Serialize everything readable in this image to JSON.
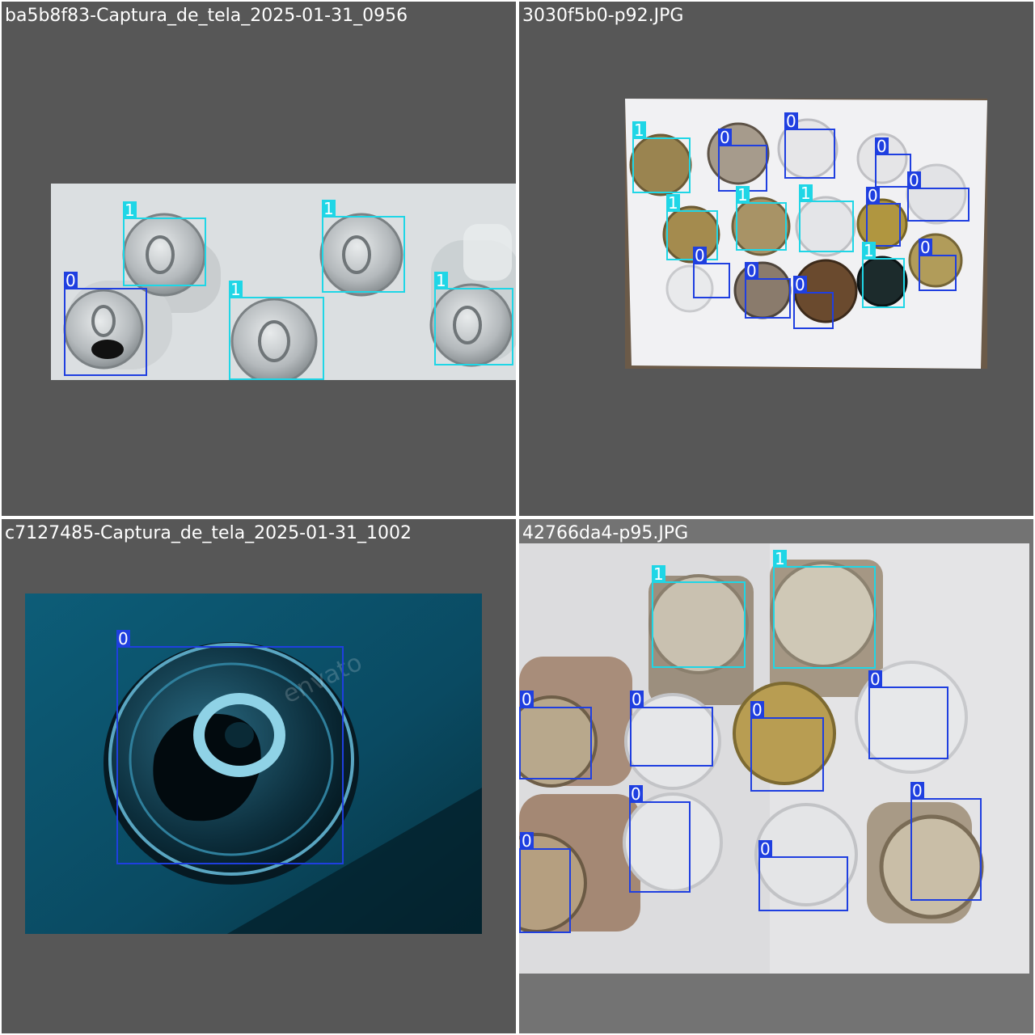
{
  "colors": {
    "class_0": "#1f3fe0",
    "class_1": "#1fd6e6",
    "tile_bg": "#575757",
    "title_text": "#ffffff"
  },
  "tiles": [
    {
      "title": "ba5b8f83-Captura_de_tela_2025-01-31_0956",
      "detections": [
        {
          "label": "1"
        },
        {
          "label": "1"
        },
        {
          "label": "0"
        },
        {
          "label": "1"
        },
        {
          "label": "1"
        }
      ]
    },
    {
      "title": "3030f5b0-p92.JPG",
      "detections": [
        {
          "label": "1"
        },
        {
          "label": "0"
        },
        {
          "label": "0"
        },
        {
          "label": "0"
        },
        {
          "label": "0"
        },
        {
          "label": "1"
        },
        {
          "label": "1"
        },
        {
          "label": "1"
        },
        {
          "label": "0"
        },
        {
          "label": "0"
        },
        {
          "label": "0"
        },
        {
          "label": "0"
        },
        {
          "label": "1"
        },
        {
          "label": "0"
        }
      ]
    },
    {
      "title": "c7127485-Captura_de_tela_2025-01-31_1002",
      "watermark": "envato",
      "detections": [
        {
          "label": "0"
        }
      ]
    },
    {
      "title": "42766da4-p95.JPG",
      "detections": [
        {
          "label": "1"
        },
        {
          "label": "1"
        },
        {
          "label": "0"
        },
        {
          "label": "0"
        },
        {
          "label": "0"
        },
        {
          "label": "0"
        },
        {
          "label": "0"
        },
        {
          "label": "0"
        },
        {
          "label": "0"
        },
        {
          "label": "0"
        }
      ]
    }
  ]
}
